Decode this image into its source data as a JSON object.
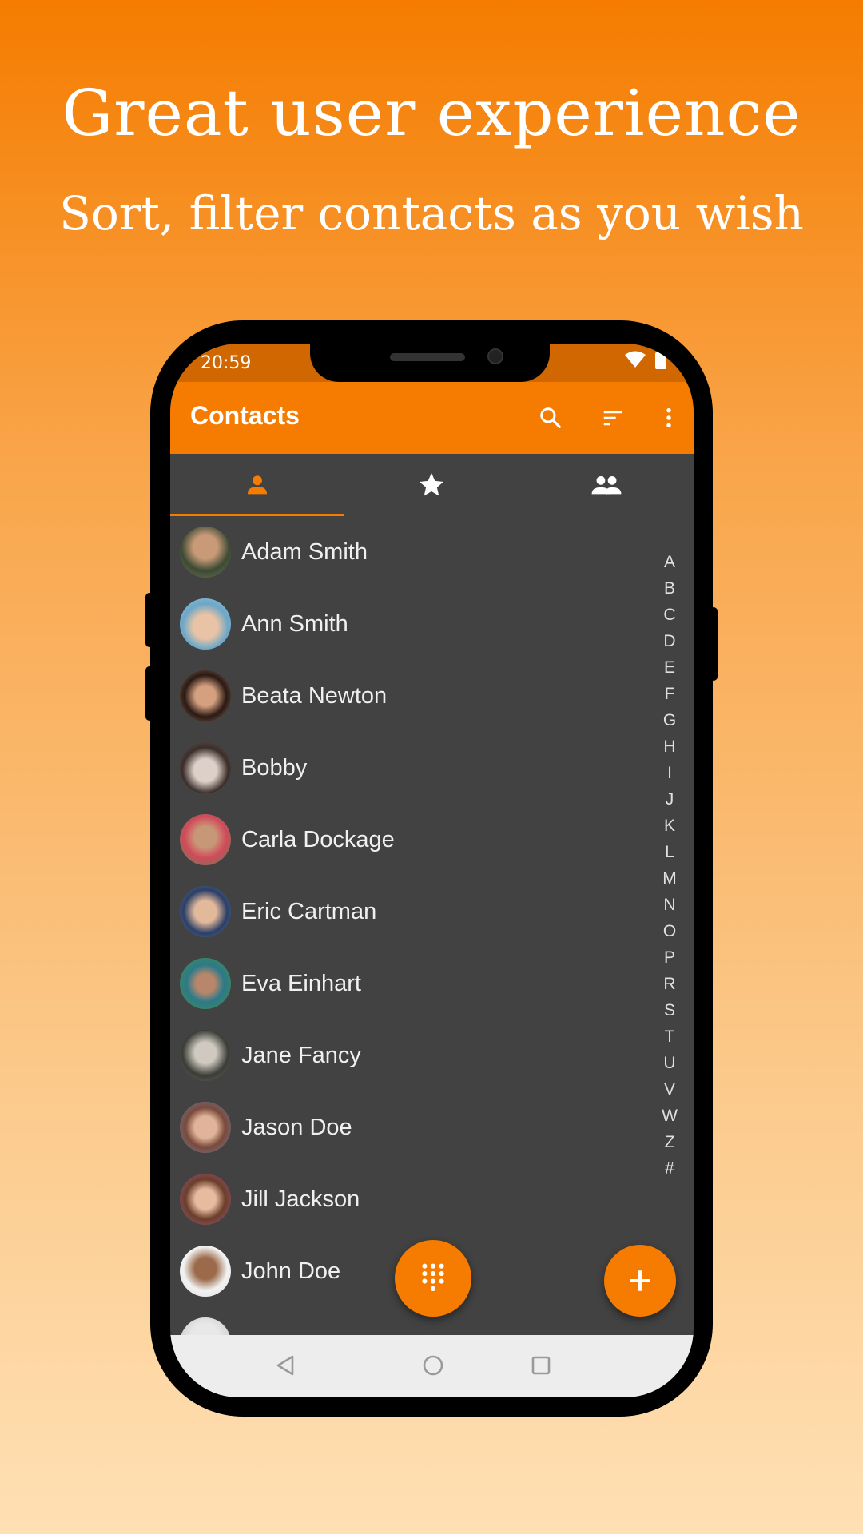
{
  "promo": {
    "headline": "Great user experience",
    "subheadline": "Sort, filter contacts as you wish"
  },
  "status_bar": {
    "time": "20:59",
    "icons": [
      "wifi-icon",
      "battery-icon"
    ]
  },
  "app_bar": {
    "title": "Contacts",
    "actions": [
      "search-icon",
      "sort-icon",
      "more-vert-icon"
    ]
  },
  "tabs": [
    {
      "icon": "person-icon",
      "selected": true
    },
    {
      "icon": "star-icon",
      "selected": false
    },
    {
      "icon": "group-icon",
      "selected": false
    }
  ],
  "contacts": [
    {
      "name": "Adam Smith"
    },
    {
      "name": "Ann Smith"
    },
    {
      "name": "Beata Newton"
    },
    {
      "name": "Bobby"
    },
    {
      "name": "Carla Dockage"
    },
    {
      "name": "Eric Cartman"
    },
    {
      "name": "Eva Einhart"
    },
    {
      "name": "Jane Fancy"
    },
    {
      "name": "Jason Doe"
    },
    {
      "name": "Jill Jackson"
    },
    {
      "name": "John Doe"
    }
  ],
  "fast_scroller": [
    "A",
    "B",
    "C",
    "D",
    "E",
    "F",
    "G",
    "H",
    "I",
    "J",
    "K",
    "L",
    "M",
    "N",
    "O",
    "P",
    "R",
    "S",
    "T",
    "U",
    "V",
    "W",
    "Z",
    "#"
  ],
  "fabs": [
    "dialpad-icon",
    "add-icon"
  ],
  "nav_bar": [
    "back-icon",
    "home-icon",
    "recents-icon"
  ],
  "colors": {
    "accent": "#F57C00",
    "status_bar": "#D06700",
    "list_bg": "#424242",
    "text": "#F0F0F0"
  }
}
